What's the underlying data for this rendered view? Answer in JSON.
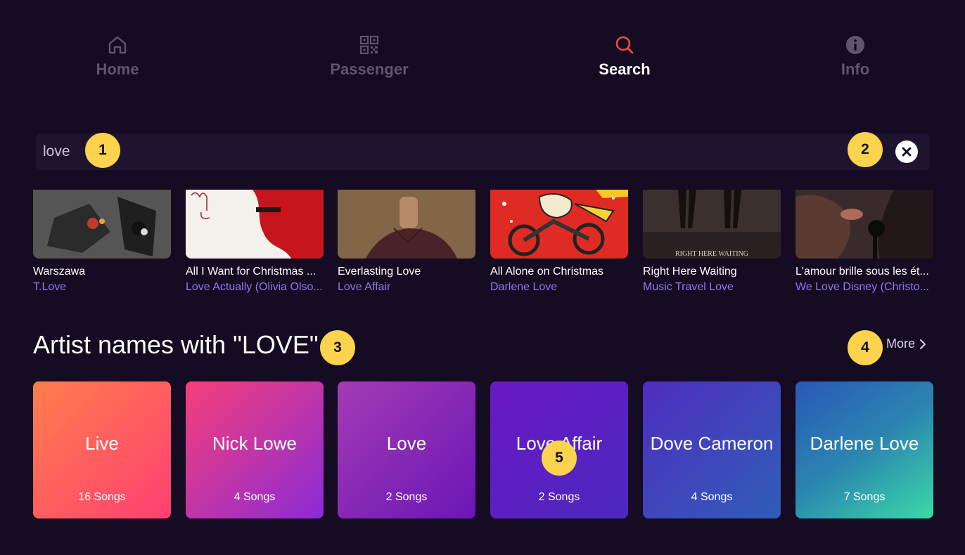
{
  "nav": {
    "items": [
      {
        "label": "Home",
        "icon": "home-icon"
      },
      {
        "label": "Passenger",
        "icon": "qr-code-icon"
      },
      {
        "label": "Search",
        "icon": "search-icon",
        "active": true
      },
      {
        "label": "Info",
        "icon": "info-icon"
      }
    ],
    "active_color": "#ef4f3f"
  },
  "search": {
    "value": "love",
    "clear_icon": "close-icon"
  },
  "songs": [
    {
      "title": "Warszawa",
      "artist": "T.Love"
    },
    {
      "title": "All I Want for Christmas ...",
      "artist": "Love Actually (Olivia Olso..."
    },
    {
      "title": "Everlasting Love",
      "artist": "Love Affair"
    },
    {
      "title": "All Alone on Christmas",
      "artist": "Darlene Love"
    },
    {
      "title": "Right Here Waiting",
      "artist": "Music Travel Love",
      "art_text": "RIGHT HERE WAITING"
    },
    {
      "title": "L'amour brille sous les ét...",
      "artist": "We Love Disney (Christo..."
    }
  ],
  "artist_section": {
    "title": "Artist names with \"LOVE\"",
    "more_label": "More",
    "artists": [
      {
        "name": "Live",
        "count": "16 Songs"
      },
      {
        "name": "Nick Lowe",
        "count": "4 Songs"
      },
      {
        "name": "Love",
        "count": "2 Songs"
      },
      {
        "name": "Love Affair",
        "count": "2 Songs"
      },
      {
        "name": "Dove Cameron",
        "count": "4 Songs"
      },
      {
        "name": "Darlene Love",
        "count": "7 Songs"
      }
    ]
  },
  "badges": [
    "1",
    "2",
    "3",
    "4",
    "5"
  ],
  "colors": {
    "background": "#150b22",
    "search_bg": "#1e1430",
    "artist_link": "#8f79f0",
    "badge": "#fcd34d"
  }
}
